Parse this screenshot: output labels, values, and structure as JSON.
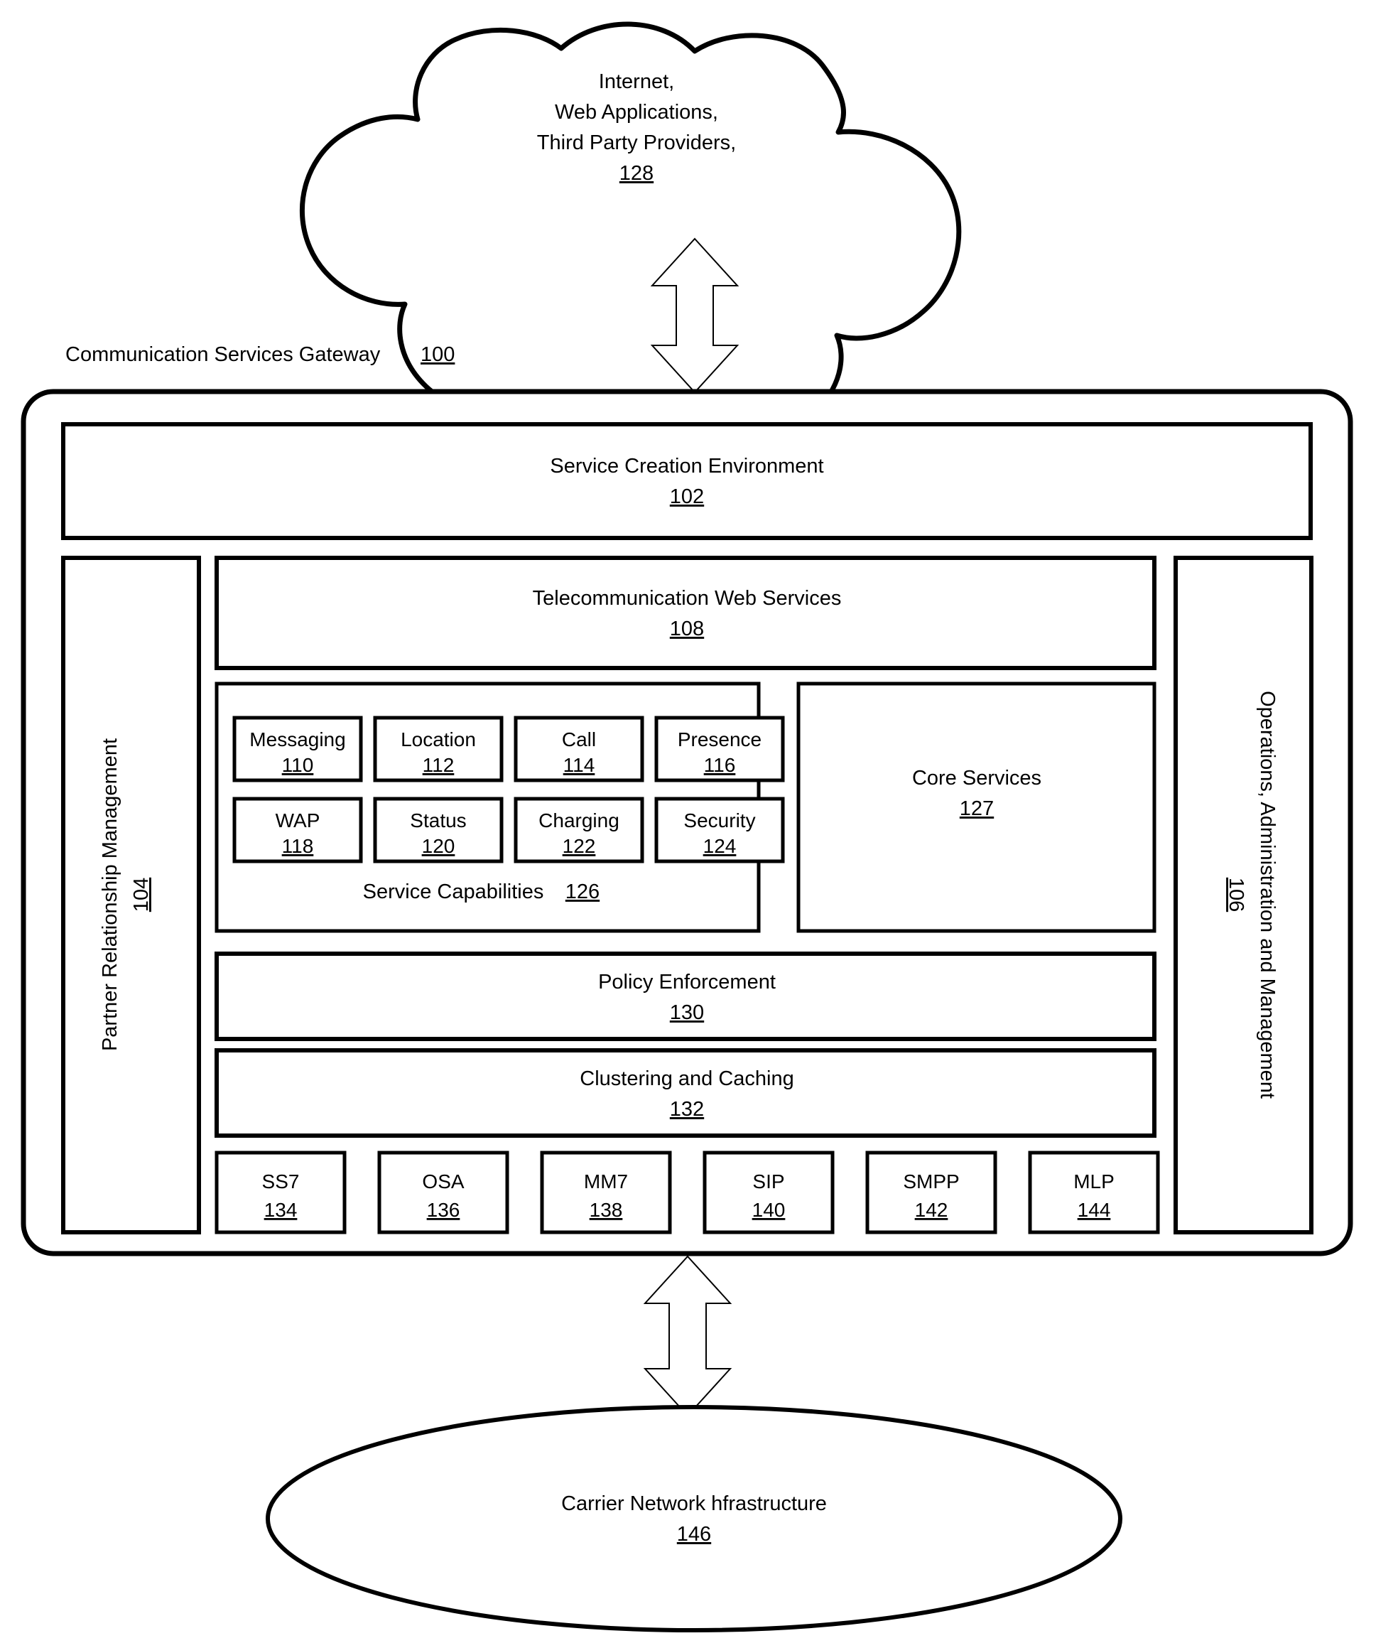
{
  "figure": {
    "gateway_title": "Communication Services Gateway",
    "gateway_ref": "100"
  },
  "cloud": {
    "line1": "Internet,",
    "line2": "Web Applications,",
    "line3": "Third Party Providers,",
    "ref": "128"
  },
  "service_creation": {
    "label": "Service Creation Environment",
    "ref": "102"
  },
  "partner_relationship": {
    "label": "Partner Relationship Management",
    "ref": "104"
  },
  "operations_admin": {
    "label": "Operations, Administration and Management",
    "ref": "106"
  },
  "telecom_web_services": {
    "label": "Telecommunication Web Services",
    "ref": "108"
  },
  "service_capabilities": {
    "caption_label": "Service Capabilities",
    "caption_ref": "126",
    "items": [
      {
        "label": "Messaging",
        "ref": "110"
      },
      {
        "label": "Location",
        "ref": "112"
      },
      {
        "label": "Call",
        "ref": "114"
      },
      {
        "label": "Presence",
        "ref": "116"
      },
      {
        "label": "WAP",
        "ref": "118"
      },
      {
        "label": "Status",
        "ref": "120"
      },
      {
        "label": "Charging",
        "ref": "122"
      },
      {
        "label": "Security",
        "ref": "124"
      }
    ]
  },
  "core_services": {
    "label": "Core Services",
    "ref": "127"
  },
  "policy_enforcement": {
    "label": "Policy Enforcement",
    "ref": "130"
  },
  "clustering_caching": {
    "label": "Clustering and Caching",
    "ref": "132"
  },
  "protocols": [
    {
      "label": "SS7",
      "ref": "134"
    },
    {
      "label": "OSA",
      "ref": "136"
    },
    {
      "label": "MM7",
      "ref": "138"
    },
    {
      "label": "SIP",
      "ref": "140"
    },
    {
      "label": "SMPP",
      "ref": "142"
    },
    {
      "label": "MLP",
      "ref": "144"
    }
  ],
  "carrier_network": {
    "label": "Carrier Network hfrastructure",
    "ref": "146"
  },
  "connectors": {
    "top_arrow": "double-headed-vertical-arrow",
    "bottom_arrow": "double-headed-vertical-arrow"
  },
  "colors": {
    "stroke": "#000000",
    "fill": "#ffffff"
  }
}
